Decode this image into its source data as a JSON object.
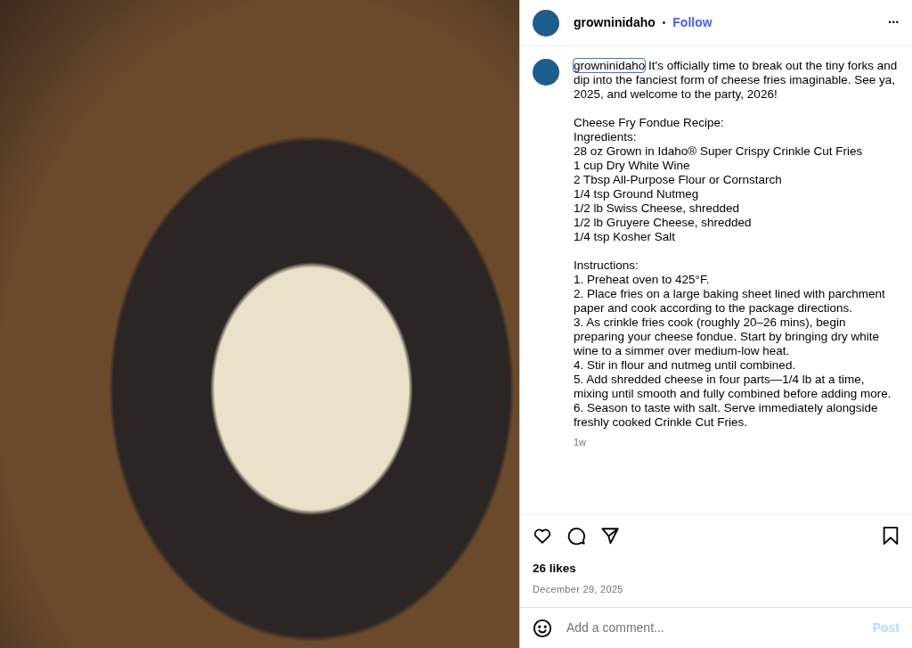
{
  "header": {
    "username": "growninidaho",
    "separator": "•",
    "follow": "Follow",
    "more": "•••"
  },
  "caption": {
    "username": "growninidaho",
    "username_focused": true,
    "intro": "It's officially time to break out the tiny forks and dip into the fanciest form of cheese fries imaginable. See ya, 2025, and welcome to the party, 2026!",
    "sections": [
      {
        "lines": [
          "Cheese Fry Fondue Recipe:",
          "Ingredients:",
          "28 oz Grown in Idaho® Super Crispy Crinkle Cut Fries",
          "1 cup Dry White Wine",
          "2 Tbsp All-Purpose Flour or Cornstarch",
          "1/4 tsp Ground Nutmeg",
          "1/2 lb Swiss Cheese, shredded",
          "1/2 lb Gruyere Cheese, shredded",
          "1/4 tsp Kosher Salt"
        ]
      },
      {
        "lines": [
          "Instructions:",
          "1. Preheat oven to 425°F.",
          "2. Place fries on a large baking sheet lined with parchment paper and cook according to the package directions.",
          "3. As crinkle fries cook (roughly 20–26 mins), begin preparing your cheese fondue. Start by bringing dry white wine to a simmer over medium-low heat.",
          "4. Stir in flour and nutmeg until combined.",
          "5. Add shredded cheese in four parts—1/4 lb at a time, mixing until smooth and fully combined before adding more.",
          "6. Season to taste with salt. Serve immediately alongside freshly cooked Crinkle Cut Fries."
        ]
      }
    ],
    "time": "1w"
  },
  "likes": "26 likes",
  "date": "December 29, 2025",
  "comment": {
    "placeholder": "Add a comment...",
    "post": "Post",
    "post_disabled": true
  }
}
